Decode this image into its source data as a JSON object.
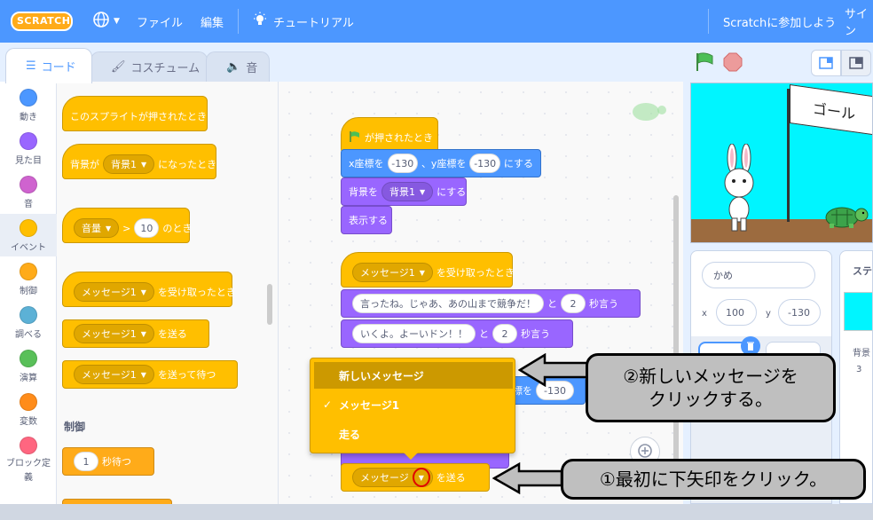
{
  "menu": {
    "logo_text": "SCRATCH",
    "file": "ファイル",
    "edit": "編集",
    "tutorial": "チュートリアル",
    "join": "Scratchに参加しよう",
    "signin": "サイン"
  },
  "tabs": {
    "code": "コード",
    "costume": "コスチューム",
    "sound": "音"
  },
  "categories": [
    {
      "label": "動き",
      "color": "#4c97ff"
    },
    {
      "label": "見た目",
      "color": "#9966ff"
    },
    {
      "label": "音",
      "color": "#cf63cf"
    },
    {
      "label": "イベント",
      "color": "#ffbf00"
    },
    {
      "label": "制御",
      "color": "#ffab19"
    },
    {
      "label": "調べる",
      "color": "#5cb1d6"
    },
    {
      "label": "演算",
      "color": "#59c059"
    },
    {
      "label": "変数",
      "color": "#ff8c1a"
    },
    {
      "label": "ブロック定義",
      "color": "#ff6680"
    }
  ],
  "palette": {
    "sprite_clicked": "このスプライトが押されたとき",
    "backdrop_prefix": "背景が",
    "backdrop_value": "背景1",
    "backdrop_suffix": "になったとき",
    "loudness_value": "音量",
    "gt": ">",
    "loudness_num": "10",
    "loudness_suffix": "のとき",
    "receive_value": "メッセージ1",
    "receive_suffix": "を受け取ったとき",
    "broadcast_value": "メッセージ1",
    "broadcast_suffix": "を送る",
    "broadcast_wait_value": "メッセージ1",
    "broadcast_wait_suffix": "を送って待つ",
    "control_title": "制御",
    "wait_num": "1",
    "wait_suffix": "秒待つ"
  },
  "script1": {
    "flag_clicked": "が押されたとき",
    "goto_x": "x座標を",
    "x_val": "-130",
    "goto_y": "、y座標を",
    "y_val": "-130",
    "goto_suffix": "にする",
    "backdrop_prefix": "背景を",
    "backdrop_value": "背景1",
    "backdrop_suffix": "にする",
    "show": "表示する"
  },
  "script2": {
    "receive_value": "メッセージ1",
    "receive_suffix": "を受け取ったとき",
    "say1_text": "言ったね。じゃあ、あの山まで競争だ！",
    "and1": "と",
    "say1_secs": "2",
    "say_suffix1": "秒言う",
    "say2_text": "いくよ。よーいドン！！",
    "and2": "と",
    "say2_secs": "2",
    "say_suffix2": "秒言う",
    "partial_coord": "座標を",
    "partial_val": "-130",
    "broadcast_value": "メッセージ",
    "broadcast_suffix": "を送る"
  },
  "dropdown": {
    "items": [
      {
        "label": "新しいメッセージ",
        "checked": false
      },
      {
        "label": "メッセージ1",
        "checked": true
      },
      {
        "label": "走る",
        "checked": false
      }
    ],
    "check_mark": "✓"
  },
  "stage": {
    "goal_text": "ゴール"
  },
  "sprite_info": {
    "name": "かめ",
    "x_label": "x",
    "x_val": "100",
    "y_label": "y",
    "y_val": "-130"
  },
  "stage_panel": {
    "title": "ステ",
    "backdrop_label": "背景",
    "backdrop_count": "3"
  },
  "annotations": {
    "step2_line1": "②新しいメッセージを",
    "step2_line2": "クリックする。",
    "step1": "①最初に下矢印をクリック。"
  }
}
